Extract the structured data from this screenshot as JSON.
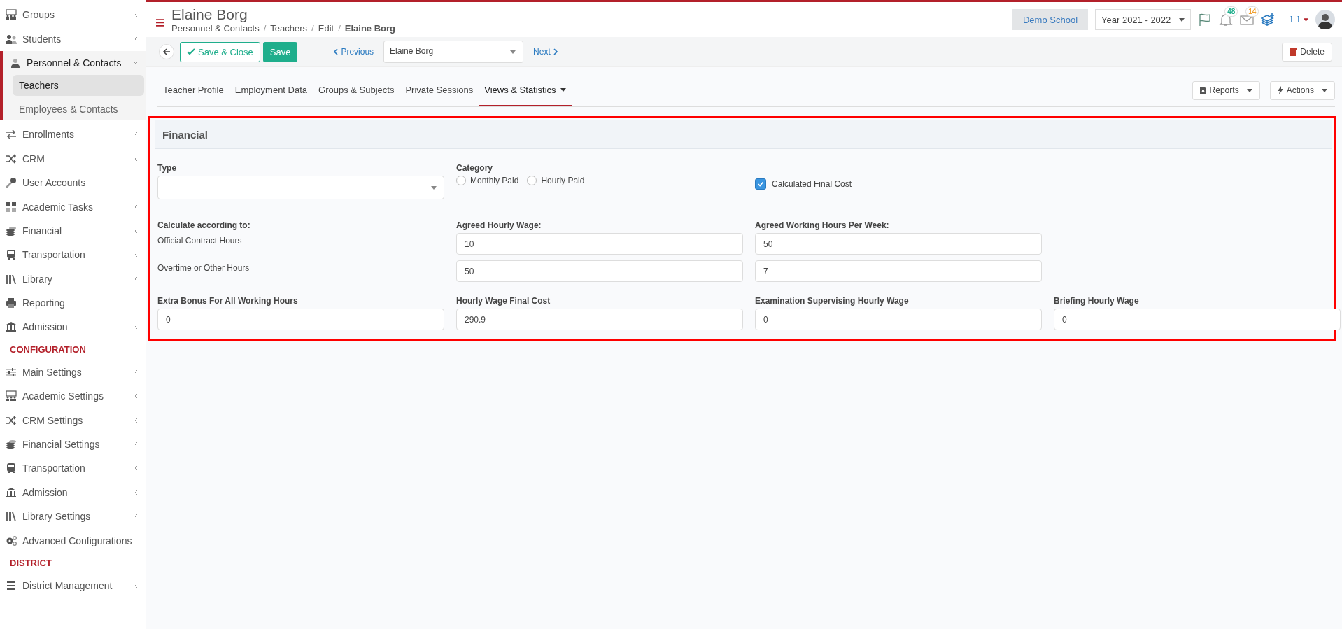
{
  "sidebar": {
    "sections": [
      {
        "items": [
          {
            "label": "Groups",
            "kind": "groups",
            "submenu": true,
            "expanded": false
          },
          {
            "label": "Students",
            "kind": "people",
            "submenu": true,
            "expanded": false
          },
          {
            "label": "Personnel & Contacts",
            "kind": "person",
            "submenu": true,
            "expanded": true,
            "children": [
              {
                "label": "Teachers",
                "selected": true
              },
              {
                "label": "Employees & Contacts",
                "selected": false
              }
            ]
          },
          {
            "label": "Enrollments",
            "kind": "exchange",
            "submenu": true,
            "expanded": false
          },
          {
            "label": "CRM",
            "kind": "shuffle",
            "submenu": true,
            "expanded": false
          },
          {
            "label": "User Accounts",
            "kind": "key",
            "submenu": false,
            "expanded": false
          },
          {
            "label": "Academic Tasks",
            "kind": "grid",
            "submenu": true,
            "expanded": false
          },
          {
            "label": "Financial",
            "kind": "coins",
            "submenu": true,
            "expanded": false
          },
          {
            "label": "Transportation",
            "kind": "bus",
            "submenu": true,
            "expanded": false
          },
          {
            "label": "Library",
            "kind": "books",
            "submenu": true,
            "expanded": false
          },
          {
            "label": "Reporting",
            "kind": "printer",
            "submenu": false,
            "expanded": false
          },
          {
            "label": "Admission",
            "kind": "bank",
            "submenu": true,
            "expanded": false
          }
        ]
      },
      {
        "heading": "CONFIGURATION",
        "items": [
          {
            "label": "Main Settings",
            "kind": "sliders",
            "submenu": true,
            "expanded": false
          },
          {
            "label": "Academic Settings",
            "kind": "groups",
            "submenu": true,
            "expanded": false
          },
          {
            "label": "CRM Settings",
            "kind": "shuffle",
            "submenu": true,
            "expanded": false
          },
          {
            "label": "Financial Settings",
            "kind": "coins",
            "submenu": true,
            "expanded": false
          },
          {
            "label": "Transportation",
            "kind": "bus",
            "submenu": true,
            "expanded": false
          },
          {
            "label": "Admission",
            "kind": "bank",
            "submenu": true,
            "expanded": false
          },
          {
            "label": "Library Settings",
            "kind": "books",
            "submenu": true,
            "expanded": false
          },
          {
            "label": "Advanced Configurations",
            "kind": "gears",
            "submenu": false,
            "expanded": false
          }
        ]
      },
      {
        "heading": "DISTRICT",
        "items": [
          {
            "label": "District Management",
            "kind": "bars",
            "submenu": true,
            "expanded": false
          }
        ]
      }
    ]
  },
  "header": {
    "title": "Elaine Borg",
    "breadcrumb": [
      "Personnel & Contacts",
      "Teachers",
      "Edit",
      "Elaine Borg"
    ],
    "breadcrumb_separator": "/",
    "school": "Demo School",
    "year": "Year 2021 - 2022",
    "notifications": "48",
    "messages": "14",
    "user": "1 1"
  },
  "toolbar": {
    "save_close": "Save & Close",
    "save": "Save",
    "previous": "Previous",
    "record": "Elaine Borg",
    "next": "Next",
    "delete": "Delete"
  },
  "tabs": [
    {
      "label": "Teacher Profile",
      "selected": false,
      "dropdown": false
    },
    {
      "label": "Employment Data",
      "selected": false,
      "dropdown": false
    },
    {
      "label": "Groups & Subjects",
      "selected": false,
      "dropdown": false
    },
    {
      "label": "Private Sessions",
      "selected": false,
      "dropdown": false
    },
    {
      "label": "Views & Statistics",
      "selected": true,
      "dropdown": true
    }
  ],
  "tab_actions": [
    "Reports",
    "Actions"
  ],
  "panel": {
    "title": "Financial",
    "type": {
      "label": "Type"
    },
    "category": {
      "label": "Category",
      "options": [
        {
          "label": "Monthly Paid",
          "selected": false
        },
        {
          "label": "Hourly Paid",
          "selected": false
        }
      ]
    },
    "final_cost_checkbox": {
      "label": "Calculated Final Cost",
      "checked": true
    },
    "calculate_label": "Calculate according to:",
    "wage_label": "Agreed Hourly Wage:",
    "hours_label": "Agreed Working Hours Per Week:",
    "rows": [
      {
        "label": "Official Contract Hours",
        "wage": "10",
        "hours": "50"
      },
      {
        "label": "Overtime or Other Hours",
        "wage": "50",
        "hours": "7"
      }
    ],
    "bottom_fields": [
      {
        "label": "Extra Bonus For All Working Hours",
        "value": "0"
      },
      {
        "label": "Hourly Wage Final Cost",
        "value": "290.9"
      },
      {
        "label": "Examination Supervising Hourly Wage",
        "value": "0"
      },
      {
        "label": "Briefing Hourly Wage",
        "value": "0"
      }
    ]
  }
}
